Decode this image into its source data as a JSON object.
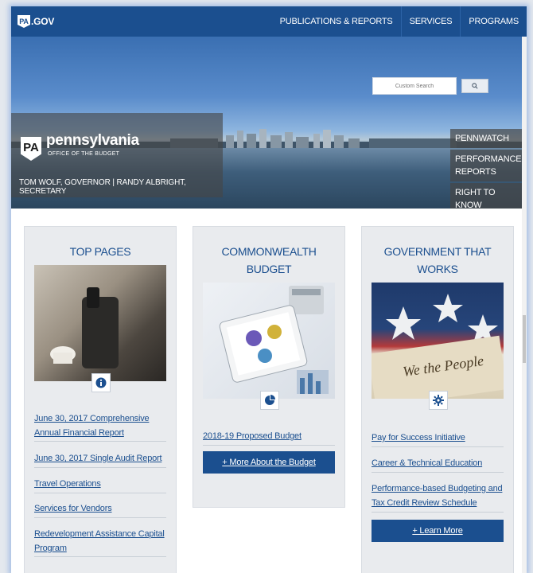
{
  "header": {
    "logo_badge": "PA",
    "logo_text": ".GOV",
    "nav": [
      {
        "label": "PUBLICATIONS & REPORTS"
      },
      {
        "label": "SERVICES"
      },
      {
        "label": "PROGRAMS"
      }
    ]
  },
  "hero": {
    "search_placeholder": "Custom Search",
    "brand": {
      "keystone": "PA",
      "name": "pennsylvania",
      "sub": "OFFICE OF THE BUDGET",
      "officials": "TOM WOLF, GOVERNOR  |  RANDY ALBRIGHT, SECRETARY"
    },
    "side_links": [
      "PENNWATCH",
      "PERFORMANCE REPORTS",
      "RIGHT TO KNOW"
    ]
  },
  "cards": {
    "top_pages": {
      "title": "TOP PAGES",
      "links": [
        "June 30, 2017 Comprehensive Annual Financial Report",
        "June 30, 2017 Single Audit Report",
        "Travel Operations",
        "Services for Vendors",
        "Redevelopment Assistance Capital Program"
      ]
    },
    "budget": {
      "title": "COMMONWEALTH BUDGET",
      "links": [
        "2018-19 Proposed Budget"
      ],
      "cta": "+ More About the Budget"
    },
    "gov_works": {
      "title": "GOVERNMENT THAT WORKS",
      "links": [
        "Pay for Success Initiative",
        "Career & Technical Education",
        "Performance-based Budgeting and Tax Credit Review Schedule"
      ],
      "cta": "+ Learn More"
    }
  },
  "colors": {
    "brand_blue": "#1b4f8f",
    "card_bg": "#e9ebee"
  },
  "icons": {
    "top_pages": "info-icon",
    "budget": "pie-chart-icon",
    "gov_works": "gear-icon"
  }
}
